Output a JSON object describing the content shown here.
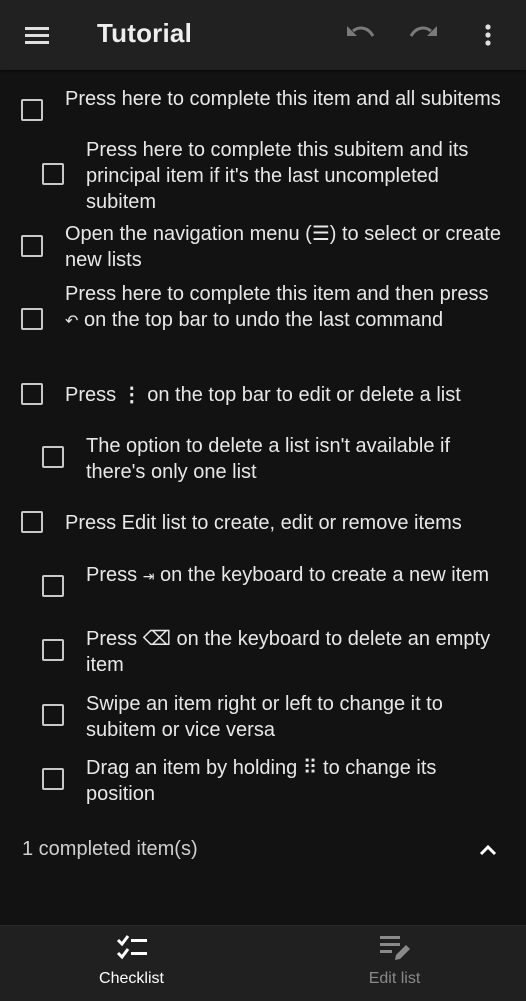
{
  "app": {
    "title": "Tutorial"
  },
  "toolbar": {
    "menu_icon": "hamburger-menu-icon",
    "undo_icon": "undo-icon",
    "redo_icon": "redo-icon",
    "more_icon": "more-vertical-icon"
  },
  "items": [
    {
      "level": "main",
      "text": "Press here to complete this item and all subitems"
    },
    {
      "level": "sub",
      "text": "Press here to complete this subitem and its principal item if it's the last uncompleted subitem"
    },
    {
      "level": "main",
      "text_before": "Open the navigation menu (",
      "glyph": "☰",
      "text_after": ") to select or create new lists"
    },
    {
      "level": "main",
      "text_before": "Press here to complete this item and then press ",
      "glyph": "↶",
      "text_after": " on the top bar to undo the last command"
    },
    {
      "level": "main",
      "text_before": "Press ",
      "glyph": "⋮",
      "text_after": " on the top bar to edit or delete a list"
    },
    {
      "level": "sub",
      "text": "The option to delete a list isn't available if there's only one list"
    },
    {
      "level": "main",
      "text": "Press Edit list to create, edit or remove items"
    },
    {
      "level": "sub",
      "text_before": "Press ",
      "glyph": "⇥",
      "text_after": " on the keyboard to create a new item"
    },
    {
      "level": "sub",
      "text_before": "Press ",
      "glyph": "⌫",
      "text_after": " on the keyboard to delete an empty item"
    },
    {
      "level": "sub",
      "text": "Swipe an item right or left to change it to subitem or vice versa"
    },
    {
      "level": "sub",
      "text_before": "Drag an item by holding ",
      "glyph": "⠿",
      "text_after": " to change its position"
    }
  ],
  "completed": {
    "label": "1 completed item(s)",
    "toggle_icon": "chevron-up-icon"
  },
  "bottom_nav": {
    "checklist_label": "Checklist",
    "edit_list_label": "Edit list",
    "active_tab": "Checklist"
  },
  "colors": {
    "background": "#121212",
    "bar": "#212121",
    "text": "#e8e8e8",
    "inactive": "#8a8a8a"
  }
}
